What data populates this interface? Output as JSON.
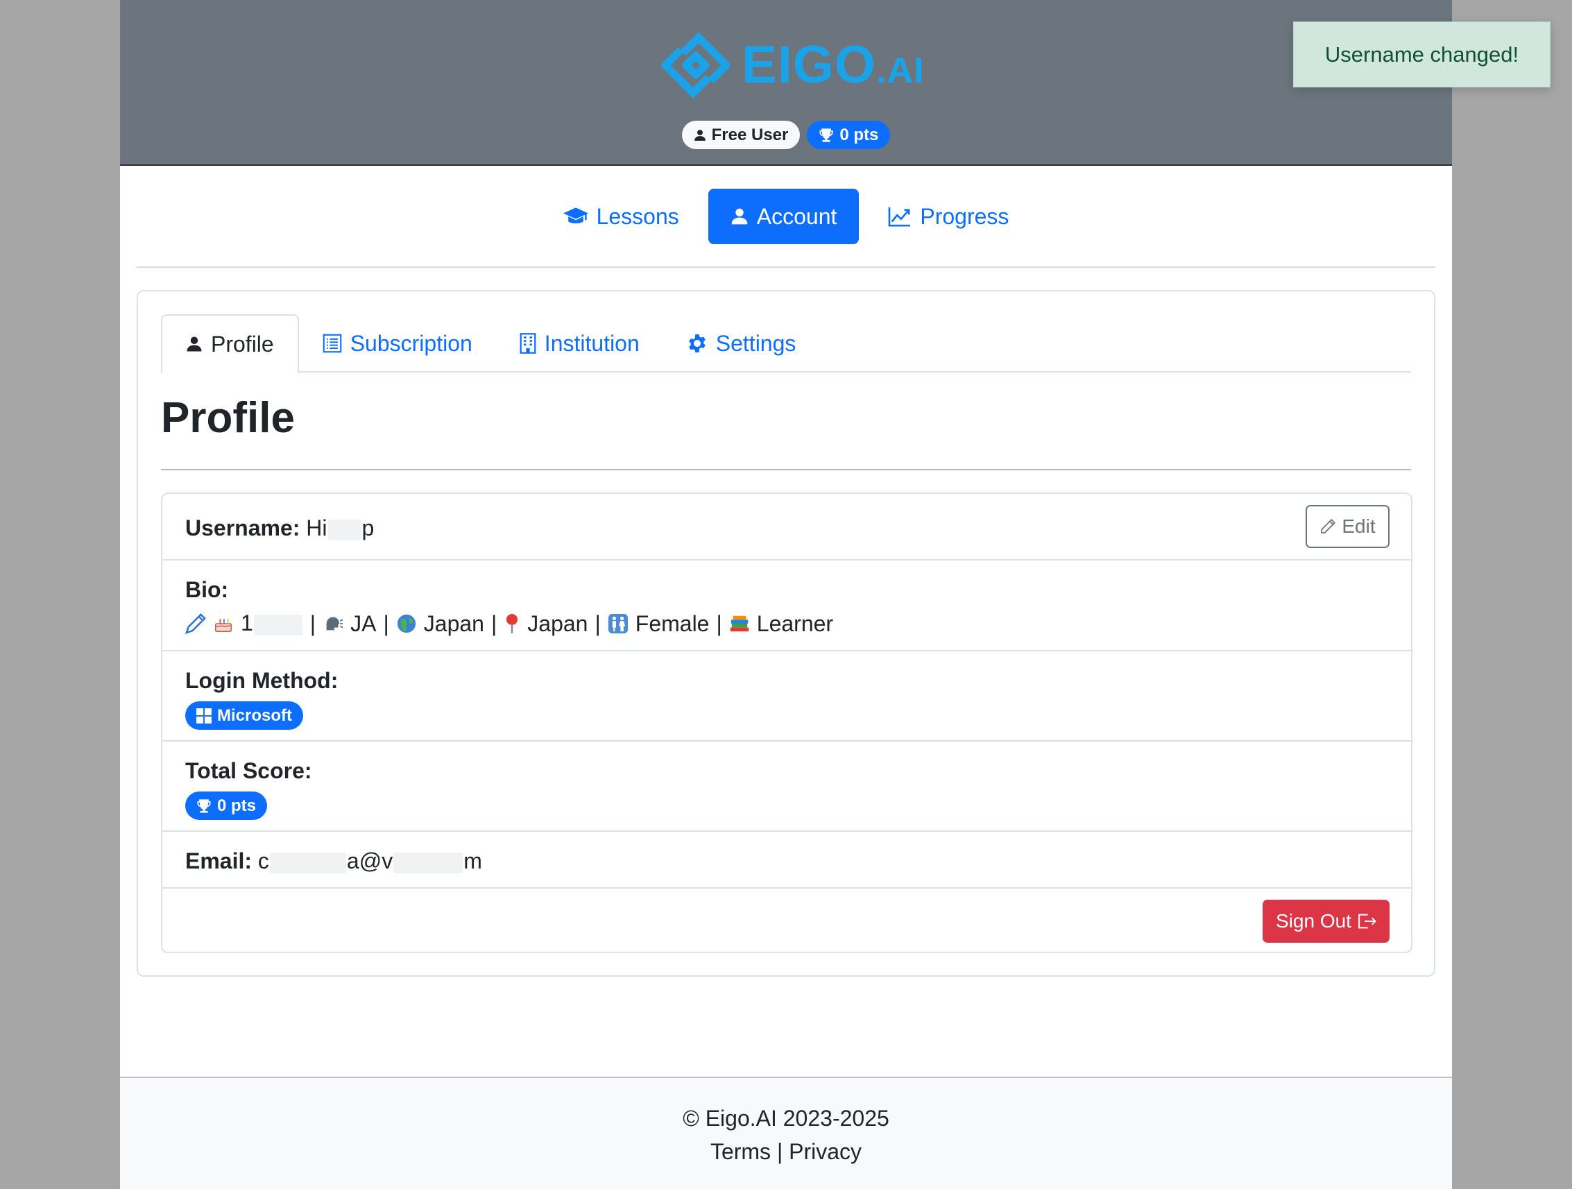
{
  "brand": {
    "name": "EIGO",
    "suffix": ".AI",
    "color": "#1aa3e8"
  },
  "header": {
    "user_badge": "Free User",
    "points_badge": "0 pts"
  },
  "toast": {
    "message": "Username changed!"
  },
  "main_nav": {
    "items": [
      {
        "label": "Lessons",
        "icon": "graduation-cap-icon"
      },
      {
        "label": "Account",
        "icon": "person-icon",
        "active": true
      },
      {
        "label": "Progress",
        "icon": "graph-up-icon"
      }
    ]
  },
  "tabs": [
    {
      "label": "Profile",
      "icon": "person-icon",
      "active": true
    },
    {
      "label": "Subscription",
      "icon": "list-icon"
    },
    {
      "label": "Institution",
      "icon": "building-icon"
    },
    {
      "label": "Settings",
      "icon": "gear-icon"
    }
  ],
  "profile": {
    "title": "Profile",
    "username_label": "Username:",
    "username_start": "Hi",
    "username_end": "p",
    "edit_label": "Edit",
    "bio_label": "Bio:",
    "bio": {
      "birthday_prefix": "1",
      "language": "JA",
      "country": "Japan",
      "location": "Japan",
      "gender": "Female",
      "role": "Learner",
      "separator": "|"
    },
    "login_label": "Login Method:",
    "login_method": "Microsoft",
    "score_label": "Total Score:",
    "score": "0 pts",
    "email_label": "Email:",
    "email_start": "c",
    "email_middle": "a@v",
    "email_end": "m",
    "signout_label": "Sign Out"
  },
  "footer": {
    "copyright": "© Eigo.AI 2023-2025",
    "terms": "Terms",
    "sep": "|",
    "privacy": "Privacy"
  },
  "colors": {
    "primary": "#0d6efd",
    "danger": "#dc3545",
    "header_bg": "#6c757d",
    "toast_bg": "#d1e7dd"
  }
}
